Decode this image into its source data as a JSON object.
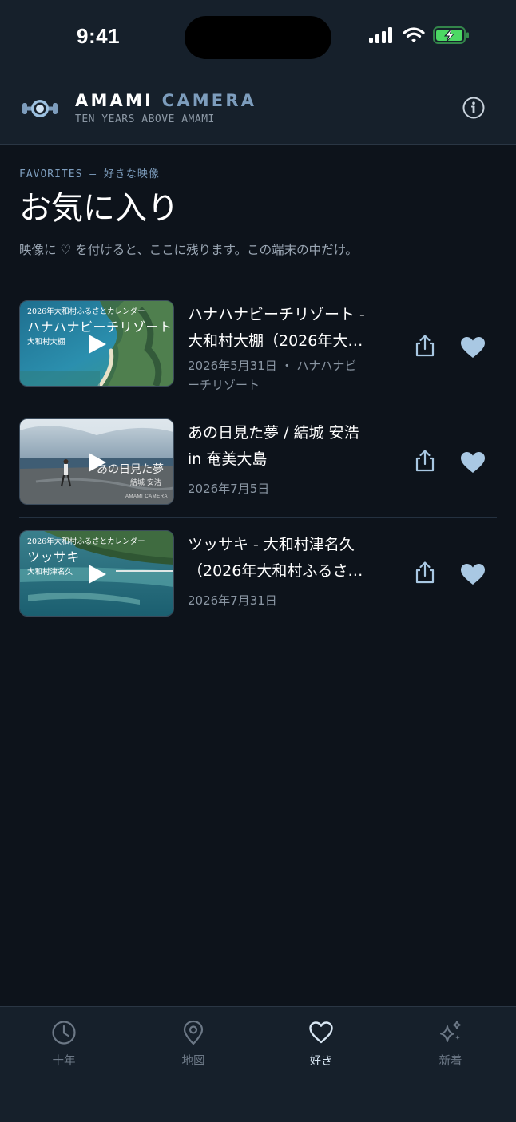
{
  "status_bar": {
    "time": "9:41"
  },
  "header": {
    "brand_primary": "AMAMI",
    "brand_accent": "CAMERA",
    "tagline": "TEN YEARS ABOVE AMAMI",
    "info_icon": "info-icon"
  },
  "page": {
    "eyebrow": "FAVORITES — 好きな映像",
    "title": "お気に入り",
    "subtitle": "映像に ♡ を付けると、ここに残ります。この端末の中だけ。"
  },
  "favorites": [
    {
      "title_line1": "ハナハナビーチリゾート -",
      "title_line2": "大和村大棚（2026年大…",
      "date_line1": "2026年5月31日 ・ ハナハナビ",
      "date_line2": "ーチリゾート",
      "thumb_caption_top": "2026年大和村ふるさとカレンダー",
      "thumb_caption_main": "ハナハナビーチリゾート",
      "thumb_caption_sub": "大和村大棚"
    },
    {
      "title_line1": "あの日見た夢 / 結城 安浩",
      "title_line2": "in 奄美大島",
      "date_line1": "2026年7月5日",
      "thumb_caption_main": "あの日見た夢",
      "thumb_caption_sub": "結城 安浩",
      "thumb_caption_brand": "AMAMI CAMERA"
    },
    {
      "title_line1": "ツッサキ - 大和村津名久",
      "title_line2": "（2026年大和村ふるさ…",
      "date_line1": "2026年7月31日",
      "thumb_caption_top": "2026年大和村ふるさとカレンダー",
      "thumb_caption_main": "ツッサキ",
      "thumb_caption_sub": "大和村津名久"
    }
  ],
  "tabs": [
    {
      "label": "十年",
      "icon": "clock-icon",
      "active": false
    },
    {
      "label": "地図",
      "icon": "map-pin-icon",
      "active": false
    },
    {
      "label": "好き",
      "icon": "heart-icon",
      "active": true
    },
    {
      "label": "新着",
      "icon": "sparkles-icon",
      "active": false
    }
  ],
  "colors": {
    "background": "#0d131b",
    "surface": "#16202b",
    "accent": "#7d9dbd",
    "heart": "#a9c8e3",
    "battery": "#4cd964"
  }
}
